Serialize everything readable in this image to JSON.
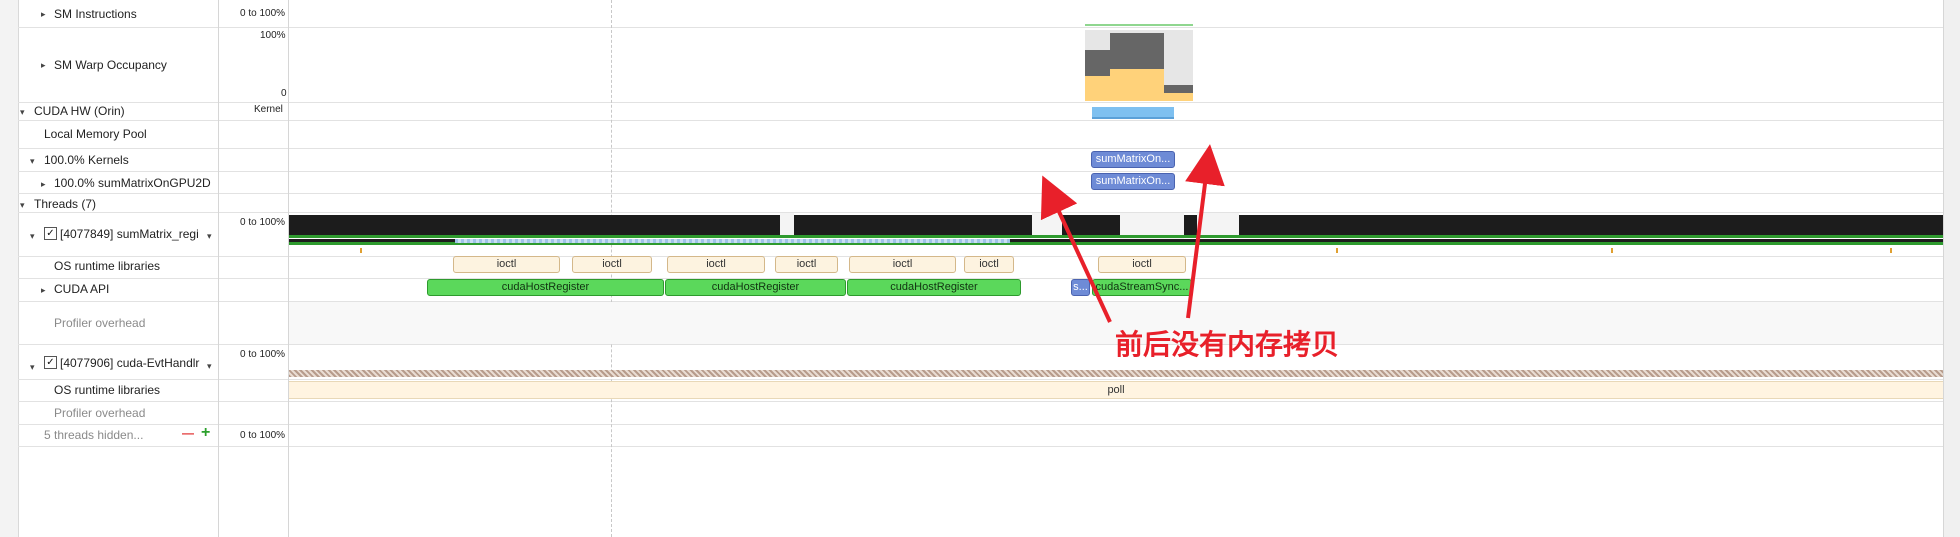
{
  "rows": {
    "sm_instructions": {
      "label": "SM Instructions",
      "scale": "0 to 100%"
    },
    "sm_warp_occupancy": {
      "label": "SM Warp Occupancy",
      "scale_top": "100%",
      "scale_bottom": "0"
    },
    "cuda_hw": {
      "label": "CUDA HW (Orin)",
      "scale": "Kernel"
    },
    "local_memory_pool": {
      "label": "Local Memory Pool"
    },
    "kernels": {
      "label": "100.0% Kernels"
    },
    "sum_matrix": {
      "label": "100.0% sumMatrixOnGPU2D"
    },
    "threads": {
      "label": "Threads (7)"
    },
    "thread1": {
      "label": "[4077849] sumMatrix_regi",
      "scale": "0 to 100%",
      "os_runtime": "OS runtime libraries",
      "cuda_api": "CUDA API",
      "profiler": "Profiler overhead"
    },
    "thread2": {
      "label": "[4077906] cuda-EvtHandlr",
      "scale": "0 to 100%",
      "os_runtime": "OS runtime libraries",
      "profiler": "Profiler overhead"
    },
    "hidden": {
      "label": "5 threads hidden...",
      "scale": "0 to 100%",
      "minus": "—",
      "plus": "+"
    }
  },
  "timeline": {
    "kernel_labels": [
      "sumMatrixOn...",
      "sumMatrixOn..."
    ],
    "ioctl_labels": [
      "ioctl",
      "ioctl",
      "ioctl",
      "ioctl",
      "ioctl",
      "ioctl",
      "ioctl"
    ],
    "cuda_api_labels": [
      "cudaHostRegister",
      "cudaHostRegister",
      "cudaHostRegister",
      "s...",
      "cudaStreamSync..."
    ],
    "poll_label": "poll"
  },
  "annotation": {
    "text": "前后没有内存拷贝",
    "color": "#e8202a"
  },
  "colors": {
    "kernel_blue": "#6e8bd6",
    "cuda_green": "#5bd85b",
    "ioctl_bg": "#fdf3e0",
    "occupancy_yellow": "#ffd27a",
    "occupancy_gray": "#666666",
    "annotation_red": "#e8202a"
  }
}
